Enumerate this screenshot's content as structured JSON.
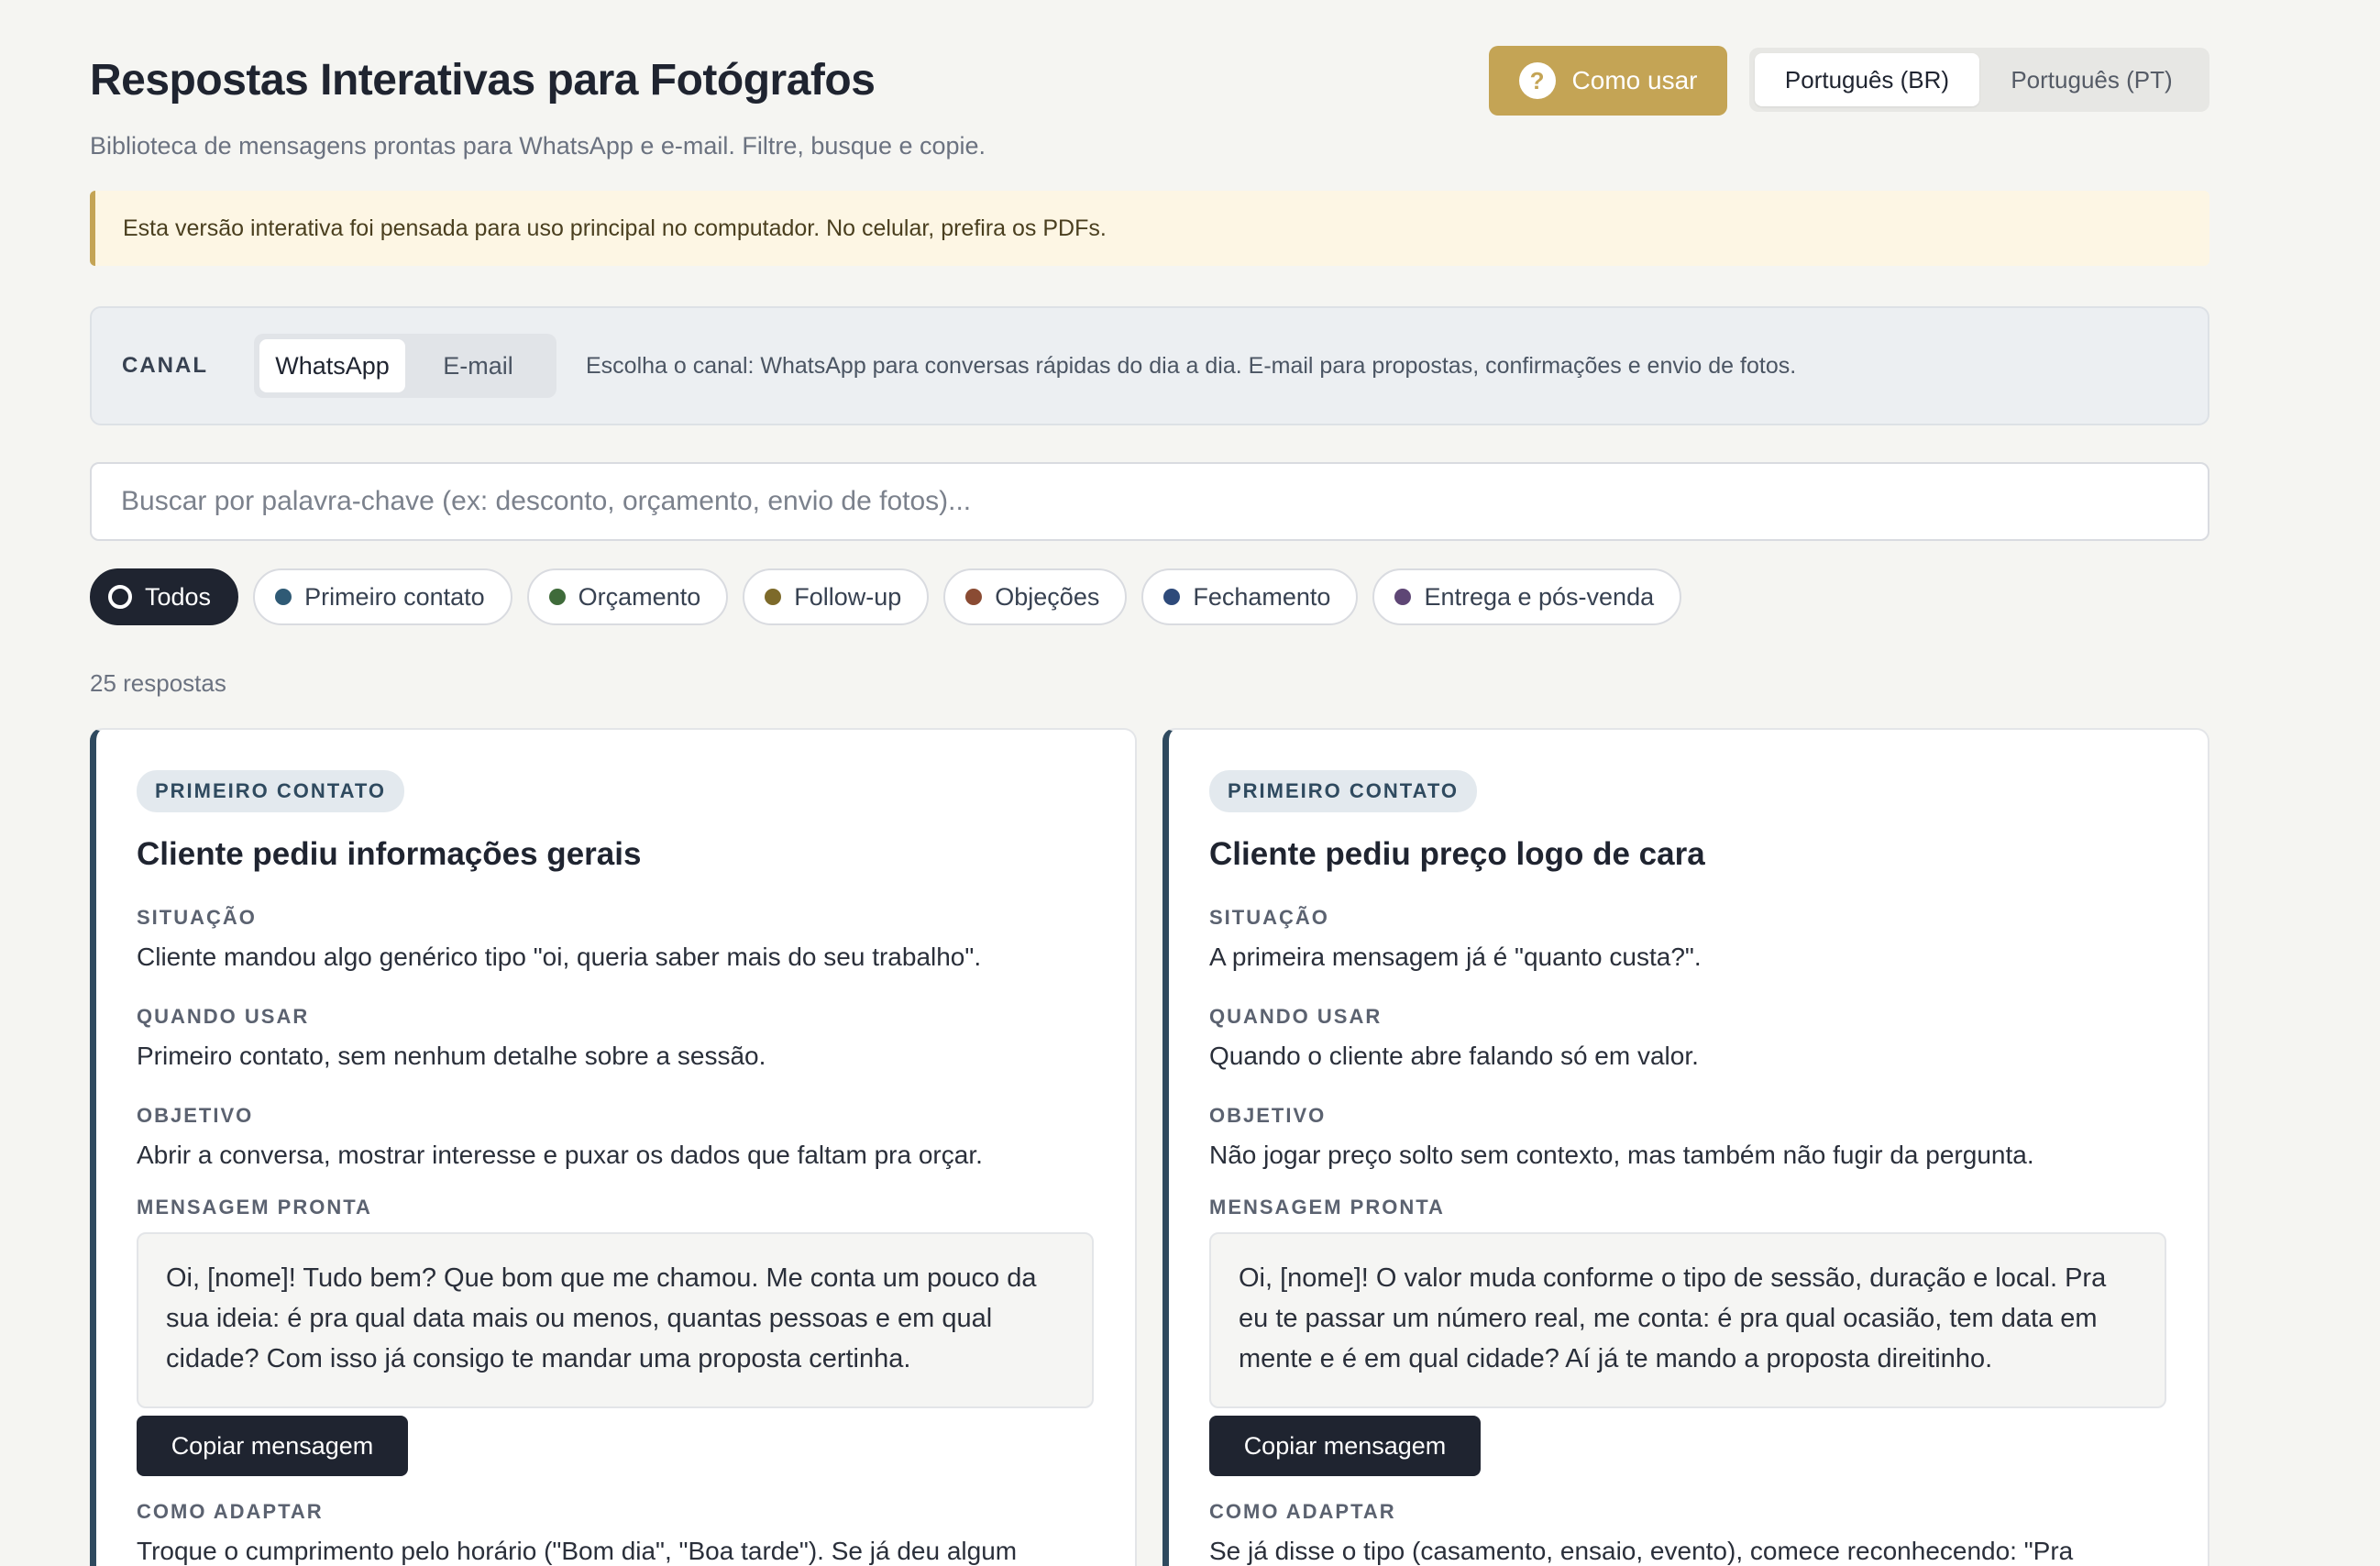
{
  "header": {
    "title": "Respostas Interativas para Fotógrafos",
    "subtitle": "Biblioteca de mensagens prontas para WhatsApp e e-mail. Filtre, busque e copie.",
    "help_label": "Como usar",
    "help_icon": "question-icon",
    "languages": [
      {
        "label": "Português (BR)",
        "active": true
      },
      {
        "label": "Português (PT)",
        "active": false
      }
    ]
  },
  "notice": "Esta versão interativa foi pensada para uso principal no computador. No celular, prefira os PDFs.",
  "channel": {
    "label": "CANAL",
    "options": [
      {
        "label": "WhatsApp",
        "active": true
      },
      {
        "label": "E-mail",
        "active": false
      }
    ],
    "description": "Escolha o canal: WhatsApp para conversas rápidas do dia a dia. E-mail para propostas, confirmações e envio de fotos."
  },
  "search": {
    "placeholder": "Buscar por palavra-chave (ex: desconto, orçamento, envio de fotos)...",
    "value": ""
  },
  "filters": [
    {
      "label": "Todos",
      "active": true,
      "color": "#ffffff"
    },
    {
      "label": "Primeiro contato",
      "active": false,
      "color": "#2f5a75"
    },
    {
      "label": "Orçamento",
      "active": false,
      "color": "#3f6b3a"
    },
    {
      "label": "Follow-up",
      "active": false,
      "color": "#7d6a2a"
    },
    {
      "label": "Objeções",
      "active": false,
      "color": "#8a4b33"
    },
    {
      "label": "Fechamento",
      "active": false,
      "color": "#2e4a7a"
    },
    {
      "label": "Entrega e pós-venda",
      "active": false,
      "color": "#5e4675"
    }
  ],
  "count": "25 respostas",
  "labels": {
    "situation": "SITUAÇÃO",
    "when": "QUANDO USAR",
    "goal": "OBJETIVO",
    "message": "MENSAGEM PRONTA",
    "copy": "Copiar mensagem",
    "adapt": "COMO ADAPTAR"
  },
  "cards": [
    {
      "badge": "PRIMEIRO CONTATO",
      "title": "Cliente pediu informações gerais",
      "situation": "Cliente mandou algo genérico tipo \"oi, queria saber mais do seu trabalho\".",
      "when": "Primeiro contato, sem nenhum detalhe sobre a sessão.",
      "goal": "Abrir a conversa, mostrar interesse e puxar os dados que faltam pra orçar.",
      "message": "Oi, [nome]! Tudo bem? Que bom que me chamou. Me conta um pouco da sua ideia: é pra qual data mais ou menos, quantas pessoas e em qual cidade? Com isso já consigo te mandar uma proposta certinha.",
      "adapt": "Troque o cumprimento pelo horário (\"Bom dia\", \"Boa tarde\"). Se já deu algum"
    },
    {
      "badge": "PRIMEIRO CONTATO",
      "title": "Cliente pediu preço logo de cara",
      "situation": "A primeira mensagem já é \"quanto custa?\".",
      "when": "Quando o cliente abre falando só em valor.",
      "goal": "Não jogar preço solto sem contexto, mas também não fugir da pergunta.",
      "message": "Oi, [nome]! O valor muda conforme o tipo de sessão, duração e local. Pra eu te passar um número real, me conta: é pra qual ocasião, tem data em mente e é em qual cidade? Aí já te mando a proposta direitinho.",
      "adapt": "Se já disse o tipo (casamento, ensaio, evento), comece reconhecendo: \"Pra"
    }
  ]
}
